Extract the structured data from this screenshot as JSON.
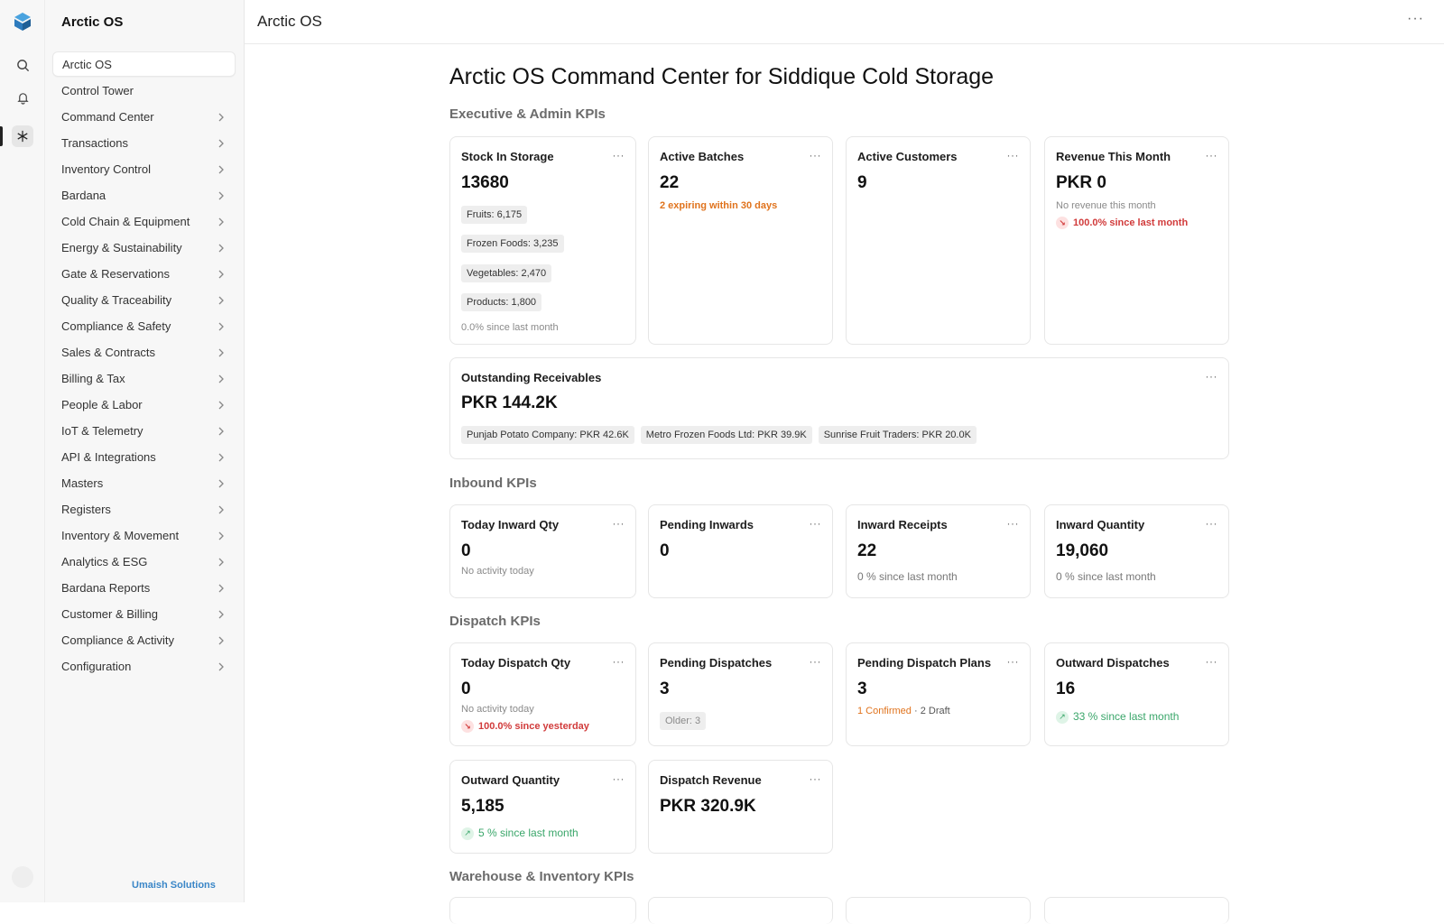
{
  "app": {
    "name": "Arctic OS",
    "footer": "Umaish Solutions"
  },
  "topbar": {
    "title": "Arctic OS",
    "more_icon": "ellipsis-icon"
  },
  "sidebar": {
    "items": [
      {
        "label": "Arctic OS",
        "active": true,
        "has_children": false
      },
      {
        "label": "Control Tower",
        "has_children": false
      },
      {
        "label": "Command Center",
        "has_children": true
      },
      {
        "label": "Transactions",
        "has_children": true
      },
      {
        "label": "Inventory Control",
        "has_children": true
      },
      {
        "label": "Bardana",
        "has_children": true
      },
      {
        "label": "Cold Chain & Equipment",
        "has_children": true
      },
      {
        "label": "Energy & Sustainability",
        "has_children": true
      },
      {
        "label": "Gate & Reservations",
        "has_children": true
      },
      {
        "label": "Quality & Traceability",
        "has_children": true
      },
      {
        "label": "Compliance & Safety",
        "has_children": true
      },
      {
        "label": "Sales & Contracts",
        "has_children": true
      },
      {
        "label": "Billing & Tax",
        "has_children": true
      },
      {
        "label": "People & Labor",
        "has_children": true
      },
      {
        "label": "IoT & Telemetry",
        "has_children": true
      },
      {
        "label": "API & Integrations",
        "has_children": true
      },
      {
        "label": "Masters",
        "has_children": true
      },
      {
        "label": "Registers",
        "has_children": true
      },
      {
        "label": "Inventory & Movement",
        "has_children": true
      },
      {
        "label": "Analytics & ESG",
        "has_children": true
      },
      {
        "label": "Bardana Reports",
        "has_children": true
      },
      {
        "label": "Customer & Billing",
        "has_children": true
      },
      {
        "label": "Compliance & Activity",
        "has_children": true
      },
      {
        "label": "Configuration",
        "has_children": true
      }
    ]
  },
  "page": {
    "title": "Arctic OS Command Center for Siddique Cold Storage",
    "sections": {
      "executive": "Executive & Admin KPIs",
      "inbound": "Inbound KPIs",
      "dispatch": "Dispatch KPIs",
      "warehouse": "Warehouse & Inventory KPIs"
    }
  },
  "cards": {
    "stock": {
      "title": "Stock In Storage",
      "value": "13680",
      "chips": [
        "Fruits: 6,175",
        "Frozen Foods: 3,235",
        "Vegetables: 2,470",
        "Products: 1,800"
      ],
      "trend": "0.0% since last month"
    },
    "batches": {
      "title": "Active Batches",
      "value": "22",
      "note": "2 expiring within 30 days"
    },
    "customers": {
      "title": "Active Customers",
      "value": "9"
    },
    "revenue": {
      "title": "Revenue This Month",
      "value": "PKR 0",
      "note": "No revenue this month",
      "trend": "100.0% since last month"
    },
    "receivables": {
      "title": "Outstanding Receivables",
      "value": "PKR 144.2K",
      "chips": [
        "Punjab Potato Company: PKR 42.6K",
        "Metro Frozen Foods Ltd: PKR 39.9K",
        "Sunrise Fruit Traders: PKR 20.0K"
      ]
    },
    "today_inward": {
      "title": "Today Inward Qty",
      "value": "0",
      "note": "No activity today"
    },
    "pending_inwards": {
      "title": "Pending Inwards",
      "value": "0"
    },
    "inward_receipts": {
      "title": "Inward Receipts",
      "value": "22",
      "trend": "0 % since last month"
    },
    "inward_quantity": {
      "title": "Inward Quantity",
      "value": "19,060",
      "trend": "0 % since last month"
    },
    "today_dispatch": {
      "title": "Today Dispatch Qty",
      "value": "0",
      "note": "No activity today",
      "trend": "100.0% since yesterday"
    },
    "pending_dispatches": {
      "title": "Pending Dispatches",
      "value": "3",
      "chip": "Older: 3"
    },
    "pending_plans": {
      "title": "Pending Dispatch Plans",
      "value": "3",
      "confirmed": "1 Confirmed",
      "sep": " · ",
      "draft": "2 Draft"
    },
    "outward_dispatches": {
      "title": "Outward Dispatches",
      "value": "16",
      "trend": "33 % since last month"
    },
    "outward_quantity": {
      "title": "Outward Quantity",
      "value": "5,185",
      "trend": "5 % since last month"
    },
    "dispatch_revenue": {
      "title": "Dispatch Revenue",
      "value": "PKR 320.9K"
    }
  },
  "colors": {
    "accent_orange": "#e0731d",
    "negative_red": "#d13b3b",
    "positive_green": "#3aa66a",
    "footer_blue": "#3a86c7"
  }
}
